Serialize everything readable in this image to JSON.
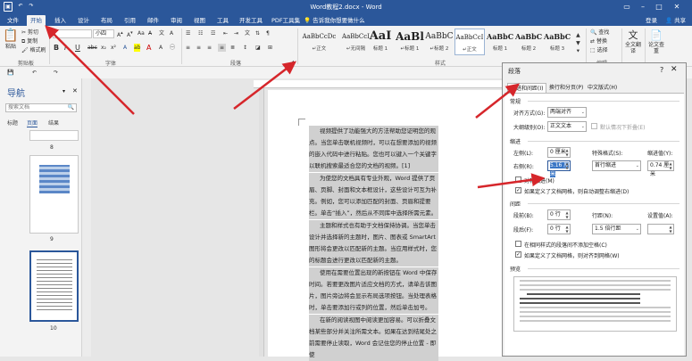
{
  "window": {
    "title": "Word教程2.docx - Word",
    "login": "登录",
    "share": "共享"
  },
  "tabs": [
    "文件",
    "开始",
    "插入",
    "设计",
    "布局",
    "引用",
    "邮件",
    "审阅",
    "视图",
    "工具",
    "开发工具",
    "PDF工具集"
  ],
  "tell_me": "告诉我你想要做什么",
  "ribbon": {
    "clipboard": {
      "paste": "粘贴",
      "cut": "剪切",
      "copy": "复制",
      "format_painter": "格式刷",
      "label": "剪贴板"
    },
    "font": {
      "name": "",
      "size": "小四",
      "label": "字体"
    },
    "paragraph_label": "段落",
    "styles": {
      "label": "样式",
      "items": [
        {
          "sample": "AaBbCcDc",
          "name": "↵正文"
        },
        {
          "sample": "AaBbCcI",
          "name": "↵无间隔"
        },
        {
          "sample": "AaI",
          "name": "标题 1"
        },
        {
          "sample": "AaBl",
          "name": "↵标题 1"
        },
        {
          "sample": "AaBbC",
          "name": "↵标题 2"
        },
        {
          "sample": "AaBbC",
          "name": "↵标题 3"
        },
        {
          "sample": "AaBbCcl",
          "name": "↵副标题"
        },
        {
          "sample": "AaBbCcI",
          "name": "↵正文"
        },
        {
          "sample": "AaBbC",
          "name": "标题 1"
        },
        {
          "sample": "AaBbC",
          "name": "标题 2"
        },
        {
          "sample": "AaBbC",
          "name": "标题 3"
        }
      ]
    },
    "editing": {
      "find": "查找",
      "replace": "替换",
      "select": "选择",
      "label": "编辑"
    },
    "fulltext": {
      "label": "全文翻译"
    },
    "paper": {
      "label": "论文查重"
    }
  },
  "nav": {
    "title": "导航",
    "search_placeholder": "搜索文档",
    "tabs": [
      "标题",
      "页面",
      "结果"
    ],
    "pages": [
      "8",
      "9",
      "10"
    ]
  },
  "document": {
    "paragraphs": [
      "视频提供了功能强大的方法帮助您证明您的观点。当您单击联机视频时，可以在想要添加的视频的嵌入代码中进行粘贴。您也可以键入一个关键字以联机搜索最适合您的文档的视频。[1]",
      "为使您的文档具有专业外观，Word 提供了页眉、页脚、封面和文本框设计，这些设计可互为补充。例如，您可以添加匹配的封面、页眉和提要栏。单击“插入”，然后从不同库中选择所需元素。",
      "主题和样式也有助于文档保持协调。当您单击设计并选择新的主题时，图片、图表或 SmartArt 图形将会更改以匹配新的主题。当应用样式时，您的标题会进行更改以匹配新的主题。",
      "使用在需要位置出现的新按钮在 Word 中保存时间。若要更改图片适应文档的方式，请单击该图片，图片旁边将会显示布局选项按钮。当处理表格时，单击要添加行或列的位置，然后单击加号。",
      "在新的阅读视图中阅读更加容易。可以折叠文档某些部分并关注所需文本。如果在达到结尾处之前需要停止读取，Word 会记住您的停止位置 - 即使"
    ]
  },
  "dialog": {
    "title": "段落",
    "tabs": [
      "缩进和间距(I)",
      "换行和分页(P)",
      "中文版式(H)"
    ],
    "general": {
      "label": "常规",
      "alignment_label": "对齐方式(G):",
      "alignment": "两端对齐",
      "outline_label": "大纲级别(O):",
      "outline": "正文文本",
      "collapse": "默认情况下折叠(E)"
    },
    "indent": {
      "label": "缩进",
      "left_label": "左侧(L):",
      "left": "0 厘米",
      "right_label": "右侧(R):",
      "right": "5.16 厘米",
      "special_label": "特殊格式(S):",
      "special": "首行缩进",
      "by_label": "缩进值(Y):",
      "by": "0.74 厘米",
      "mirror": "对称缩进(M)",
      "auto_adjust": "如果定义了文档网格，则自动调整右缩进(D)"
    },
    "spacing": {
      "label": "间距",
      "before_label": "段前(B):",
      "before": "0 行",
      "after_label": "段后(F):",
      "after": "0 行",
      "line_label": "行距(N):",
      "line": "1.5 倍行距",
      "at_label": "设置值(A):",
      "at": "",
      "no_space": "在相同样式的段落间不添加空格(C)",
      "snap": "如果定义了文档网格，则对齐到网格(W)"
    },
    "preview_label": "预览"
  },
  "colors": {
    "brand": "#2b579a",
    "arrow": "#d6262b"
  }
}
